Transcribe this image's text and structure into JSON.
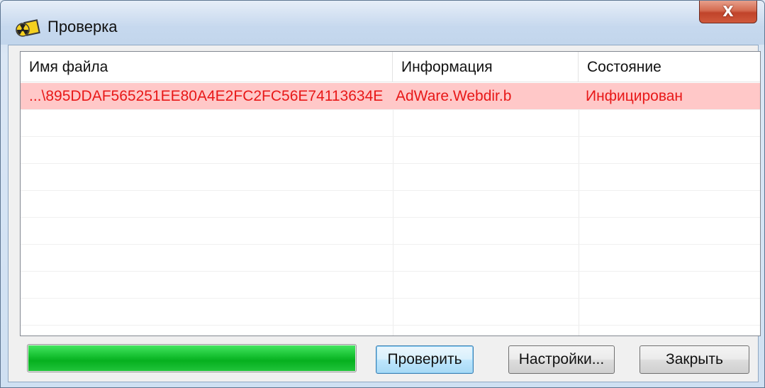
{
  "window": {
    "title": "Проверка",
    "close_symbol": "X"
  },
  "table": {
    "columns": [
      "Имя файла",
      "Информация",
      "Состояние"
    ],
    "rows": [
      {
        "file": "...\\895DDAF565251EE80A4E2FC2FC56E74113634E",
        "info": "AdWare.Webdir.b",
        "state": "Инфицирован"
      }
    ]
  },
  "progress": {
    "value": 1.0
  },
  "buttons": {
    "check": "Проверить",
    "settings": "Настройки...",
    "close": "Закрыть"
  },
  "colors": {
    "infected_row_bg": "#ffc8c8",
    "infected_text": "#e81818",
    "progress_fill": "#0fbb2a"
  },
  "icons": {
    "app": "radiation-warning-icon"
  }
}
